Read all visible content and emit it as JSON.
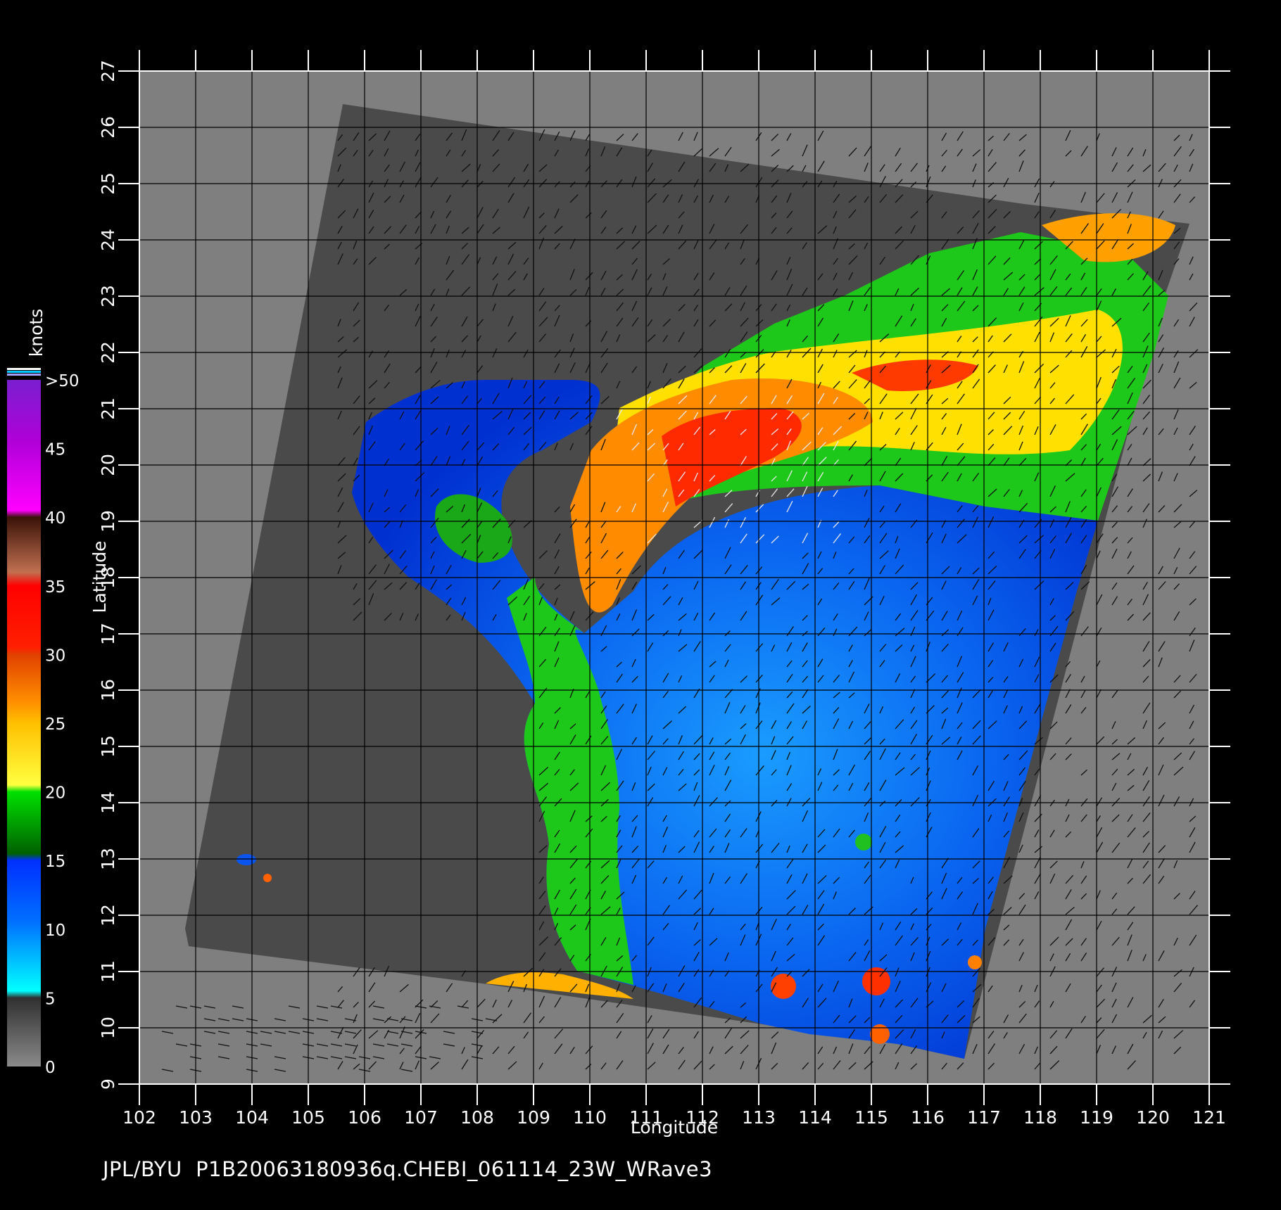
{
  "map": {
    "x_axis": {
      "label": "Longitude",
      "ticks": [
        "102",
        "103",
        "104",
        "105",
        "106",
        "107",
        "108",
        "109",
        "110",
        "111",
        "112",
        "113",
        "114",
        "115",
        "116",
        "117",
        "118",
        "119",
        "120",
        "121"
      ]
    },
    "y_axis": {
      "label": "Latitude",
      "ticks": [
        "9",
        "10",
        "11",
        "12",
        "13",
        "14",
        "15",
        "16",
        "17",
        "18",
        "19",
        "20",
        "21",
        "22",
        "23",
        "24",
        "25",
        "26",
        "27"
      ]
    },
    "lon_range": [
      102,
      121
    ],
    "lat_range": [
      9,
      27
    ],
    "grid": true
  },
  "colorbar": {
    "title": "knots",
    "labels": [
      ">50",
      "45",
      "40",
      "35",
      "30",
      "25",
      "20",
      "15",
      "10",
      "5",
      "0"
    ],
    "colors": {
      "above50": "#7a1fd0",
      "c45": "#b000d8",
      "c40": "#ff00ff",
      "c35": "#5a2010",
      "c30": "#ff0000",
      "c25": "#ff7a00",
      "c20": "#ffff00",
      "c15": "#00c000",
      "c10": "#0040ff",
      "c5": "#00ffff",
      "c0": "#444444"
    }
  },
  "footer": {
    "credit": "JPL/BYU",
    "filename": "P1B20063180936q.CHEBI_061114_23W_WRave3"
  }
}
